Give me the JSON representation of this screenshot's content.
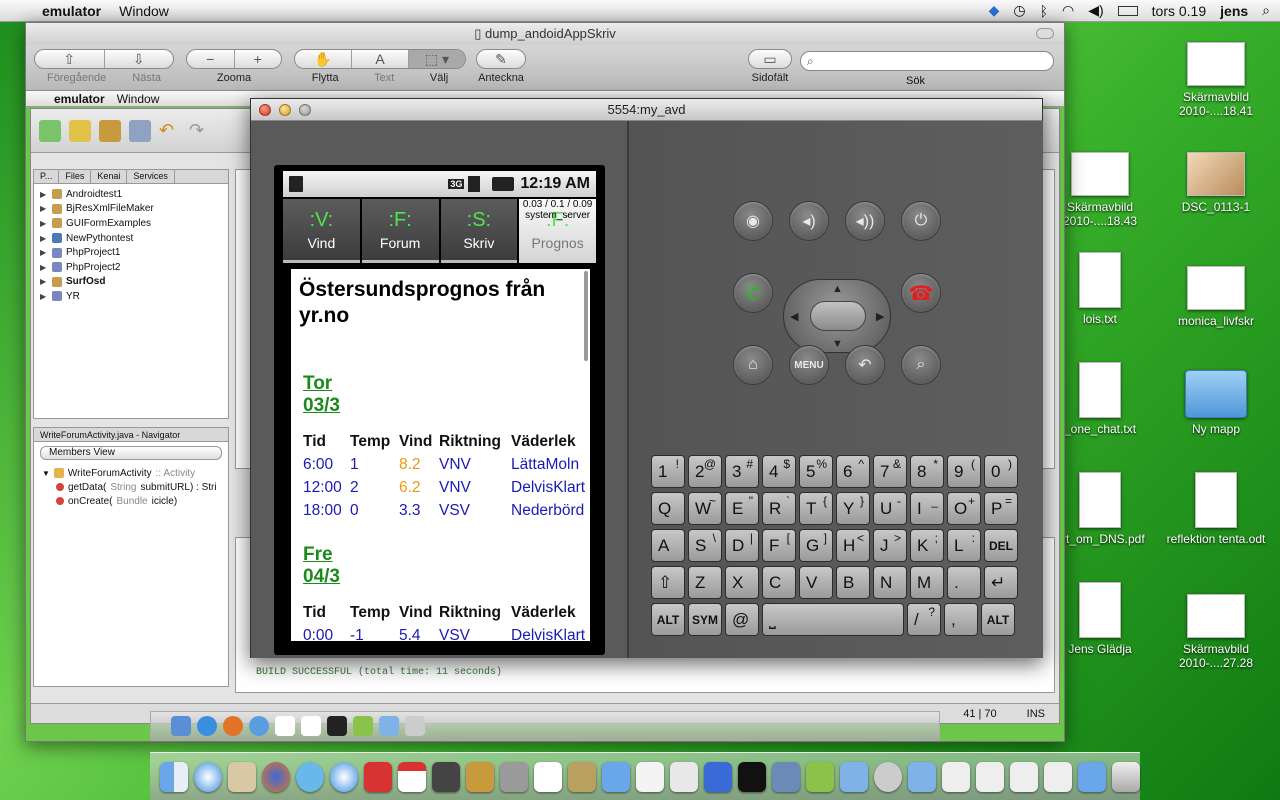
{
  "menubar": {
    "app": "emulator",
    "menu_window": "Window",
    "clock": "tors 0.19",
    "user": "jens"
  },
  "preview": {
    "title": "dump_andoidAppSkriv",
    "toolbar": {
      "prev": "Föregående",
      "next": "Nästa",
      "zoom": "Zooma",
      "move": "Flytta",
      "text": "Text",
      "select": "Välj",
      "annotate": "Anteckna",
      "sidebar": "Sidofält",
      "search_label": "Sök"
    }
  },
  "netbeans": {
    "menubar": {
      "app": "emulator",
      "menu_window": "Window"
    },
    "projects_tabs": [
      "P...",
      "Files",
      "Kenai",
      "Services"
    ],
    "projects": [
      "Androidtest1",
      "BjResXmlFileMaker",
      "GUIFormExamples",
      "NewPythontest",
      "PhpProject1",
      "PhpProject2",
      "SurfOsd",
      "YR"
    ],
    "navigator_title": "WriteForumActivity.java - Navigator",
    "members_view": "Members View",
    "nav_class": "WriteForumActivity",
    "nav_class_super": ":: Activity",
    "nav_methods": [
      {
        "name": "getData(",
        "type": "String",
        "param": " submitURL) : Stri"
      },
      {
        "name": "onCreate(",
        "type": "Bundle",
        "param": " icicle)"
      }
    ],
    "build_output": "BUILD SUCCESSFUL (total time: 11 seconds)",
    "status_pos": "41 | 70",
    "status_mode": "INS"
  },
  "emulator": {
    "title": "5554:my_avd",
    "status_time": "12:19 AM",
    "status_net": "3G",
    "tabs": [
      {
        "glyph": ":V:",
        "label": "Vind"
      },
      {
        "glyph": ":F:",
        "label": "Forum"
      },
      {
        "glyph": ":S:",
        "label": "Skriv"
      },
      {
        "glyph": ":F:",
        "label": "Prognos"
      }
    ],
    "load_overlay": "0.03 / 0.1 / 0.09",
    "load_overlay2": "system_server",
    "heading": "Östersundsprognos från yr.no",
    "forecast_headers": [
      "Tid",
      "Temp",
      "Vind",
      "Riktning",
      "Väderlek"
    ],
    "days": [
      {
        "name": "Tor",
        "date": "03/3",
        "rows": [
          [
            "6:00",
            "1",
            "8.2",
            "VNV",
            "LättaMoln"
          ],
          [
            "12:00",
            "2",
            "6.2",
            "VNV",
            "DelvisKlart"
          ],
          [
            "18:00",
            "0",
            "3.3",
            "VSV",
            "Nederbörd"
          ]
        ]
      },
      {
        "name": "Fre",
        "date": "04/3",
        "rows": [
          [
            "0:00",
            "-1",
            "5.4",
            "VSV",
            "DelvisKlart"
          ]
        ]
      }
    ],
    "menu_key": "MENU",
    "keyboard": {
      "row1": [
        [
          "1",
          "!"
        ],
        [
          "2",
          "@"
        ],
        [
          "3",
          "#"
        ],
        [
          "4",
          "$"
        ],
        [
          "5",
          "%"
        ],
        [
          "6",
          "^"
        ],
        [
          "7",
          "&"
        ],
        [
          "8",
          "*"
        ],
        [
          "9",
          "("
        ],
        [
          "0",
          ")"
        ]
      ],
      "row2": [
        [
          "Q",
          ""
        ],
        [
          "W",
          "~"
        ],
        [
          "E",
          "\""
        ],
        [
          "R",
          "`"
        ],
        [
          "T",
          "{"
        ],
        [
          "Y",
          "}"
        ],
        [
          "U",
          "-"
        ],
        [
          "I",
          "_"
        ],
        [
          "O",
          "+"
        ],
        [
          "P",
          "="
        ]
      ],
      "row3": [
        [
          "A",
          ""
        ],
        [
          "S",
          "\\"
        ],
        [
          "D",
          "|"
        ],
        [
          "F",
          "["
        ],
        [
          "G",
          "]"
        ],
        [
          "H",
          "<"
        ],
        [
          "J",
          ">"
        ],
        [
          "K",
          ";"
        ],
        [
          "L",
          ":"
        ],
        [
          "DEL",
          ""
        ]
      ],
      "row4": [
        [
          "⇧",
          ""
        ],
        [
          "Z",
          ""
        ],
        [
          "X",
          ""
        ],
        [
          "C",
          ""
        ],
        [
          "V",
          ""
        ],
        [
          "B",
          ""
        ],
        [
          "N",
          ""
        ],
        [
          "M",
          ""
        ],
        [
          ".",
          ""
        ],
        [
          "↵",
          ""
        ]
      ],
      "row5": [
        [
          "ALT",
          ""
        ],
        [
          "SYM",
          ""
        ],
        [
          "@",
          ""
        ],
        [
          "⎵",
          ""
        ],
        [
          "/",
          "?"
        ],
        [
          ",",
          ""
        ],
        [
          "ALT",
          ""
        ]
      ]
    }
  },
  "desktop_icons": [
    {
      "label": "Skärmavbild 2010-....18.41"
    },
    {
      "label": "Skärmavbild 2010-....18.43"
    },
    {
      "label": "DSC_0113-1"
    },
    {
      "label": "lois.txt"
    },
    {
      "label": "monica_livfskr"
    },
    {
      "label": "_one_chat.txt"
    },
    {
      "label": "Ny mapp"
    },
    {
      "label": "ort_om_DNS.pdf"
    },
    {
      "label": "reflektion tenta.odt"
    },
    {
      "label": "Jens Glädja"
    },
    {
      "label": "Skärmavbild 2010-....27.28"
    }
  ],
  "colors": {
    "desktop": "#38b02a",
    "tab_glyph": "#4ee64e",
    "day_heading": "#1a8a1a",
    "table_value": "#1a1ab4",
    "wind_warn": "#e89b13"
  }
}
